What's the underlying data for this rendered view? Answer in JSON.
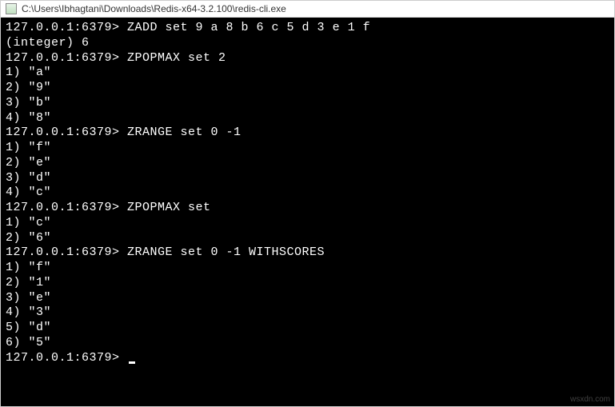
{
  "titlebar": {
    "path": "C:\\Users\\Ibhagtani\\Downloads\\Redis-x64-3.2.100\\redis-cli.exe"
  },
  "prompt": "127.0.0.1:6379>",
  "session": [
    {
      "type": "cmd",
      "text": "ZADD set 9 a 8 b 6 c 5 d 3 e 1 f"
    },
    {
      "type": "out",
      "text": "(integer) 6"
    },
    {
      "type": "cmd",
      "text": "ZPOPMAX set 2"
    },
    {
      "type": "out",
      "text": "1) \"a\""
    },
    {
      "type": "out",
      "text": "2) \"9\""
    },
    {
      "type": "out",
      "text": "3) \"b\""
    },
    {
      "type": "out",
      "text": "4) \"8\""
    },
    {
      "type": "cmd",
      "text": "ZRANGE set 0 -1"
    },
    {
      "type": "out",
      "text": "1) \"f\""
    },
    {
      "type": "out",
      "text": "2) \"e\""
    },
    {
      "type": "out",
      "text": "3) \"d\""
    },
    {
      "type": "out",
      "text": "4) \"c\""
    },
    {
      "type": "cmd",
      "text": "ZPOPMAX set"
    },
    {
      "type": "out",
      "text": "1) \"c\""
    },
    {
      "type": "out",
      "text": "2) \"6\""
    },
    {
      "type": "cmd",
      "text": "ZRANGE set 0 -1 WITHSCORES"
    },
    {
      "type": "out",
      "text": "1) \"f\""
    },
    {
      "type": "out",
      "text": "2) \"1\""
    },
    {
      "type": "out",
      "text": "3) \"e\""
    },
    {
      "type": "out",
      "text": "4) \"3\""
    },
    {
      "type": "out",
      "text": "5) \"d\""
    },
    {
      "type": "out",
      "text": "6) \"5\""
    },
    {
      "type": "cmd",
      "text": "",
      "cursor": true
    }
  ],
  "watermark": "wsxdn.com"
}
